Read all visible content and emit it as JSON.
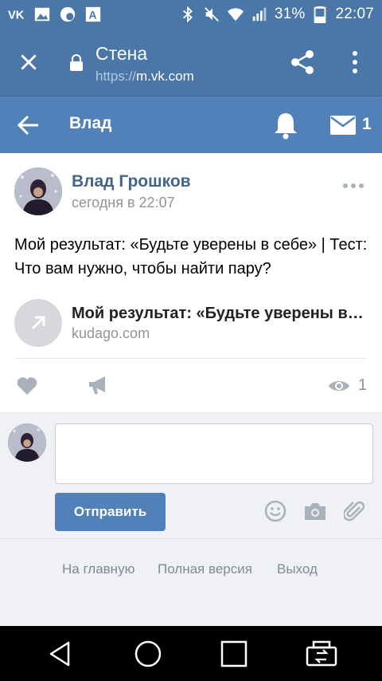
{
  "status_bar": {
    "battery": "31%",
    "time": "22:07",
    "notification_icons": [
      "vk-icon",
      "gallery-icon",
      "android-badge-icon",
      "font-icon"
    ],
    "system_icons": [
      "bluetooth-icon",
      "mute-icon",
      "wifi-icon",
      "signal-icon",
      "battery-icon"
    ]
  },
  "browser": {
    "title": "Стена",
    "url_protocol": "https://",
    "url_host": "m.vk.com"
  },
  "vk_header": {
    "title": "Влад",
    "mail_count": "1"
  },
  "post": {
    "author": "Влад Грошков",
    "time": "сегодня в 22:07",
    "text": "Мой результат: «Будьте уверены в себе» | Тест: Что вам нужно, чтобы найти пару?",
    "link_title": "Мой результат: «Будьте уверены в себе» | Тест: Что вам нужно, чтобы найти пару?",
    "link_domain": "kudago.com",
    "views": "1"
  },
  "composer": {
    "input_value": "",
    "send_label": "Отправить"
  },
  "footer": {
    "links": [
      "На главную",
      "Полная версия",
      "Выход"
    ]
  },
  "colors": {
    "status_bar": "#4a76a8",
    "vk_header": "#5181b8",
    "author_link": "#42648b",
    "muted_text": "#939393",
    "composer_bg": "#f0f1f4"
  }
}
